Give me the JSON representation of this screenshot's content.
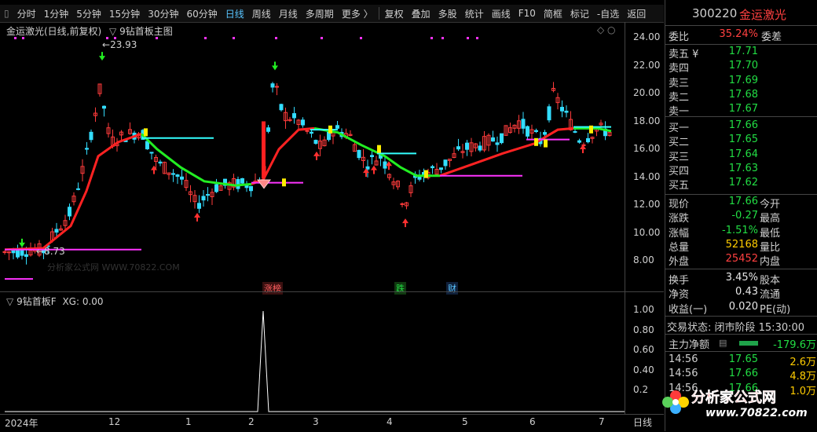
{
  "toolbar": {
    "items": [
      "分时",
      "1分钟",
      "5分钟",
      "15分钟",
      "30分钟",
      "60分钟",
      "日线",
      "周线",
      "月线",
      "多周期",
      "更多 〉",
      "复权",
      "叠加",
      "多股",
      "统计",
      "画线",
      "F10",
      "简框",
      "标记",
      "-自选",
      "返回"
    ],
    "active": "日线"
  },
  "chart": {
    "title": "金运激光(日线,前复权)",
    "formula": "9钻首板主图",
    "high_label": "23.93",
    "low_label": "8.73",
    "watermark": "分析家公式网 WWW.70822.COM",
    "price_ticks": [
      "24.00",
      "22.00",
      "20.00",
      "18.00",
      "16.00",
      "14.00",
      "12.00",
      "10.00",
      "8.00"
    ],
    "event_tags": [
      {
        "text": "涨榜",
        "color": "#ff6060"
      },
      {
        "text": "跌",
        "color": "#22dd44"
      },
      {
        "text": "财",
        "color": "#58c4ff"
      }
    ]
  },
  "indicator": {
    "title": "9钻首板F",
    "value_label": "XG: 0.00",
    "ticks": [
      "1.00",
      "0.80",
      "0.60",
      "0.40",
      "0.2"
    ]
  },
  "xaxis": {
    "labels": [
      "2024年",
      "12",
      "1",
      "2",
      "3",
      "4",
      "5",
      "6",
      "7"
    ],
    "right_label": "日线"
  },
  "quote": {
    "code": "300220",
    "name": "金运激光",
    "weibi_label": "委比",
    "weibi": "35.24%",
    "weicha_label": "委差",
    "asks": [
      {
        "label": "卖五 ¥",
        "price": "17.71"
      },
      {
        "label": "卖四",
        "price": "17.70"
      },
      {
        "label": "卖三",
        "price": "17.69"
      },
      {
        "label": "卖二",
        "price": "17.68"
      },
      {
        "label": "卖一",
        "price": "17.67"
      }
    ],
    "bids": [
      {
        "label": "买一",
        "price": "17.66"
      },
      {
        "label": "买二",
        "price": "17.65"
      },
      {
        "label": "买三",
        "price": "17.64"
      },
      {
        "label": "买四",
        "price": "17.63"
      },
      {
        "label": "买五",
        "price": "17.62"
      }
    ],
    "stats": [
      {
        "label": "现价",
        "value": "17.66",
        "color": "#22dd44",
        "label2": "今开"
      },
      {
        "label": "涨跌",
        "value": "-0.27",
        "color": "#22dd44",
        "label2": "最高"
      },
      {
        "label": "涨幅",
        "value": "-1.51%",
        "color": "#22dd44",
        "label2": "最低"
      },
      {
        "label": "总量",
        "value": "52168",
        "color": "#ffcc00",
        "label2": "量比"
      },
      {
        "label": "外盘",
        "value": "25452",
        "color": "#ff4040",
        "label2": "内盘"
      }
    ],
    "stats2": [
      {
        "label": "换手",
        "value": "3.45%",
        "label2": "股本"
      },
      {
        "label": "净资",
        "value": "0.43",
        "label2": "流通"
      },
      {
        "label": "收益(一)",
        "value": "0.020",
        "label2": "PE(动)"
      }
    ],
    "trade_status": "交易状态: 闭市阶段 15:30:00",
    "main_flow_label": "主力净额",
    "main_flow_value": "-179.6万",
    "ticks_list": [
      {
        "time": "14:56",
        "price": "17.65",
        "vol": "2.6万"
      },
      {
        "time": "14:56",
        "price": "17.66",
        "vol": "4.8万"
      },
      {
        "time": "14:56",
        "price": "17.66",
        "vol": "1.0万"
      }
    ],
    "logo_text": "分析家公式网",
    "logo_url": "www.70822.com"
  },
  "candles_summary": {
    "start_price": 8.73,
    "peak1": 23.93,
    "last_price": 17.66
  }
}
